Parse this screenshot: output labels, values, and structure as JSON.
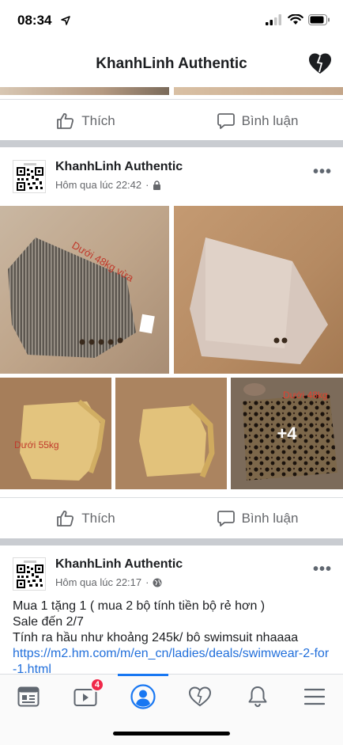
{
  "status": {
    "time": "08:34"
  },
  "header": {
    "title": "KhanhLinh Authentic"
  },
  "actions": {
    "like": "Thích",
    "comment": "Bình luận"
  },
  "posts": [
    {
      "author": "KhanhLinh Authentic",
      "time": "Hôm qua lúc 22:42",
      "privacy_icon": "lock-icon",
      "photos": [
        {
          "label": "Dưới 48kg vừa"
        },
        {
          "label": ""
        },
        {
          "label": "Dưới 55kg"
        },
        {
          "label": ""
        },
        {
          "label": "Dưới 48kg",
          "more": "+4"
        }
      ]
    },
    {
      "author": "KhanhLinh Authentic",
      "time": "Hôm qua lúc 22:17",
      "privacy_icon": "globe-icon",
      "text_lines": [
        "Mua 1 tặng 1 ( mua 2 bộ tính tiền bộ rẻ hơn )",
        "Sale đến 2/7",
        "Tính ra hầu như khoảng 245k/ bô swimsuit nhaaaa"
      ],
      "link": "https://m2.hm.com/m/en_cn/ladies/deals/swimwear-2-for-1.html"
    }
  ],
  "nav": {
    "video_badge": "4"
  },
  "colors": {
    "accent": "#1877f2",
    "badge": "#f02849",
    "link": "#216fdb"
  }
}
